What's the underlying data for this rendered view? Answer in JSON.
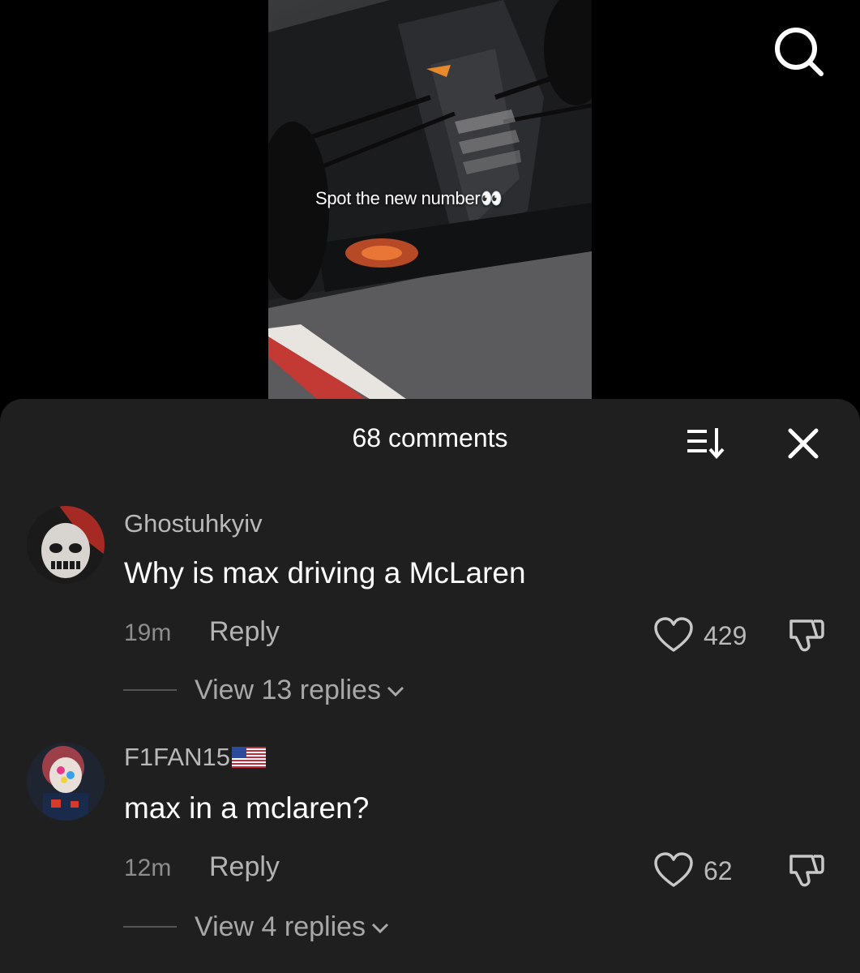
{
  "video": {
    "caption": "Spot the new number",
    "caption_emoji": "👀"
  },
  "top_bar": {
    "search_icon": "search-icon"
  },
  "comments_panel": {
    "title": "68 comments",
    "sort_icon": "sort-icon",
    "close_icon": "close-icon",
    "comments": [
      {
        "username": "Ghostuhkyiv",
        "text": "Why is max driving a McLaren",
        "time": "19m",
        "reply_label": "Reply",
        "likes": "429",
        "view_replies": "View 13 replies"
      },
      {
        "username": "F1FAN15",
        "flag": "us-flag-icon",
        "text": "max in a mclaren?",
        "time": "12m",
        "reply_label": "Reply",
        "likes": "62",
        "view_replies": "View 4 replies"
      }
    ]
  },
  "colors": {
    "background": "#000000",
    "panel": "#1f1f1f",
    "primary_text": "#ffffff",
    "secondary_text": "#b9b9b9"
  }
}
